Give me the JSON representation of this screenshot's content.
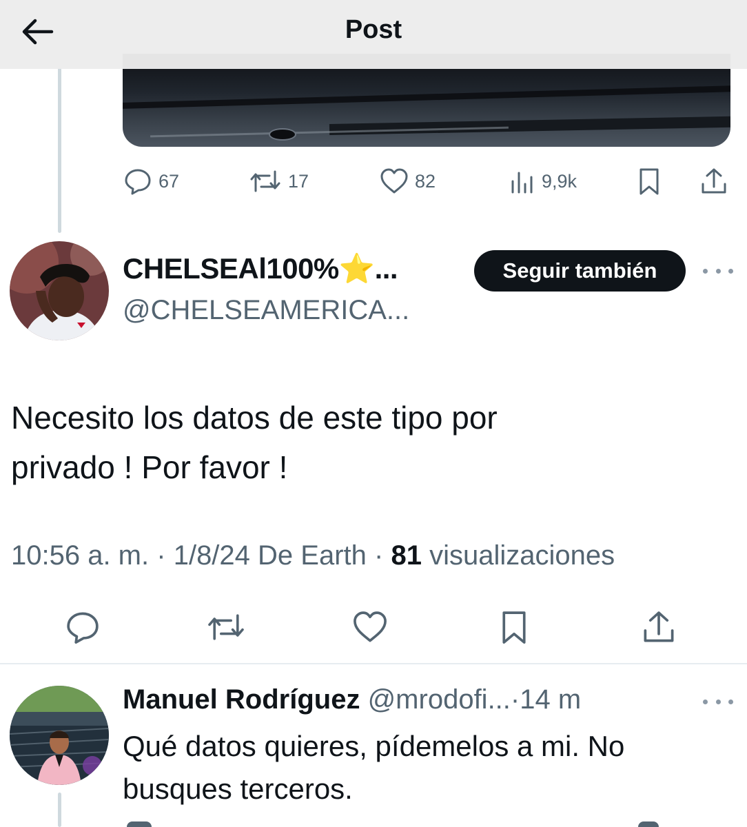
{
  "header": {
    "title": "Post",
    "back_icon": "arrow-left-icon"
  },
  "previous_post": {
    "stats": {
      "replies": "67",
      "reposts": "17",
      "likes": "82",
      "views": "9,9k"
    }
  },
  "post": {
    "author_name": "CHELSEAl100%⭐...",
    "author_handle": "@CHELSEAMERICA...",
    "follow_label": "Seguir también",
    "text_line1": "Necesito los datos de este tipo por",
    "text_line2": "privado ! Por favor !",
    "time": "10:56 a. m.",
    "date": "1/8/24",
    "source": "De Earth",
    "views_count": "81",
    "views_label": "visualizaciones"
  },
  "reply": {
    "author_name": "Manuel Rodríguez",
    "author_handle": "@mrodofi...",
    "time_ago": "14 m",
    "text_line1": "Qué datos quieres, pídemelos a mi. No",
    "text_line2": "busques terceros."
  },
  "colors": {
    "text": "#0f1419",
    "secondary": "#536471",
    "follow_button_bg": "#0f1419",
    "thread_line": "#cfd9de"
  }
}
